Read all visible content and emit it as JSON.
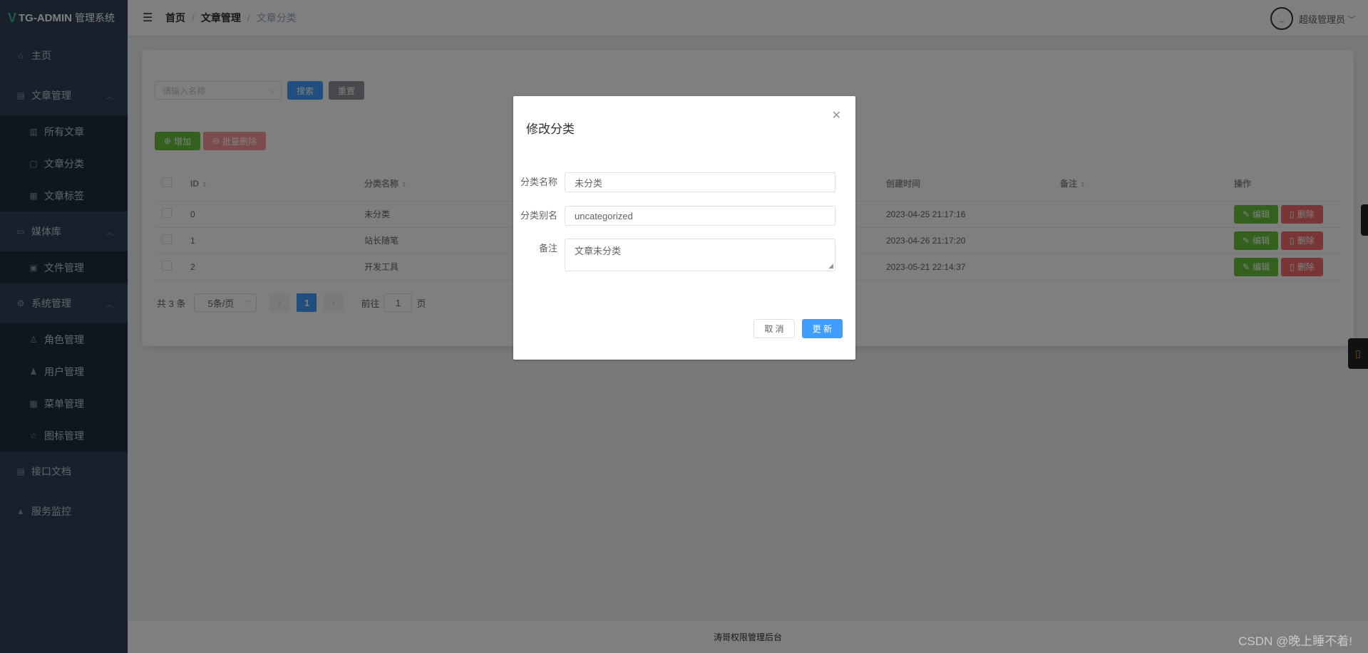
{
  "app": {
    "logo_mark": "V",
    "title": "TG-ADMIN",
    "subtitle": "管理系统"
  },
  "sidebar": {
    "items": [
      {
        "label": "主页",
        "icon": "home-icon"
      },
      {
        "label": "文章管理",
        "icon": "document-icon",
        "expandable": true
      },
      {
        "label": "所有文章",
        "icon": "columns-icon",
        "sub": true
      },
      {
        "label": "文章分类",
        "icon": "clipboard-icon",
        "sub": true
      },
      {
        "label": "文章标签",
        "icon": "grid-icon",
        "sub": true
      },
      {
        "label": "媒体库",
        "icon": "folder-icon",
        "expandable": true
      },
      {
        "label": "文件管理",
        "icon": "picture-icon",
        "sub": true
      },
      {
        "label": "系统管理",
        "icon": "gear-icon",
        "expandable": true
      },
      {
        "label": "角色管理",
        "icon": "user-outline-icon",
        "sub": true
      },
      {
        "label": "用户管理",
        "icon": "user-solid-icon",
        "sub": true
      },
      {
        "label": "菜单管理",
        "icon": "menu-grid-icon",
        "sub": true
      },
      {
        "label": "图标管理",
        "icon": "star-icon",
        "sub": true
      },
      {
        "label": "接口文档",
        "icon": "doc-list-icon"
      },
      {
        "label": "服务监控",
        "icon": "bell-icon"
      }
    ]
  },
  "header": {
    "breadcrumb": [
      "首页",
      "文章管理",
      "文章分类"
    ],
    "breadcrumb_sep": "/",
    "user_name": "超级管理员"
  },
  "toolbar": {
    "search_placeholder": "请输入名称",
    "search_label": "搜索",
    "reset_label": "重置",
    "add_label": "增加",
    "batch_delete_label": "批量删除"
  },
  "table": {
    "columns": [
      "ID",
      "分类名称",
      "创建时间",
      "备注",
      "操作"
    ],
    "rows": [
      {
        "id": "0",
        "name": "未分类",
        "created": "2023-04-25 21:17:16",
        "remark": ""
      },
      {
        "id": "1",
        "name": "站长随笔",
        "created": "2023-04-26 21:17:20",
        "remark": ""
      },
      {
        "id": "2",
        "name": "开发工具",
        "created": "2023-05-21 22:14:37",
        "remark": ""
      }
    ],
    "edit_label": "编辑",
    "delete_label": "删除"
  },
  "pager": {
    "total_text": "共 3 条",
    "page_size": "5条/页",
    "current_page": "1",
    "goto_prefix": "前往",
    "goto_value": "1",
    "goto_suffix": "页"
  },
  "footer": {
    "text": "涛哥权限管理后台"
  },
  "dialog": {
    "title": "修改分类",
    "fields": [
      {
        "label": "分类名称",
        "value": "未分类"
      },
      {
        "label": "分类别名",
        "value": "uncategorized"
      },
      {
        "label": "备注",
        "value": "文章未分类"
      }
    ],
    "cancel_label": "取 消",
    "submit_label": "更 新"
  },
  "watermark": "CSDN @晚上睡不着!",
  "colors": {
    "sidebar_bg": "#304156",
    "primary": "#409eff",
    "success": "#67c23a",
    "danger": "#f56c6c",
    "info": "#909399"
  }
}
